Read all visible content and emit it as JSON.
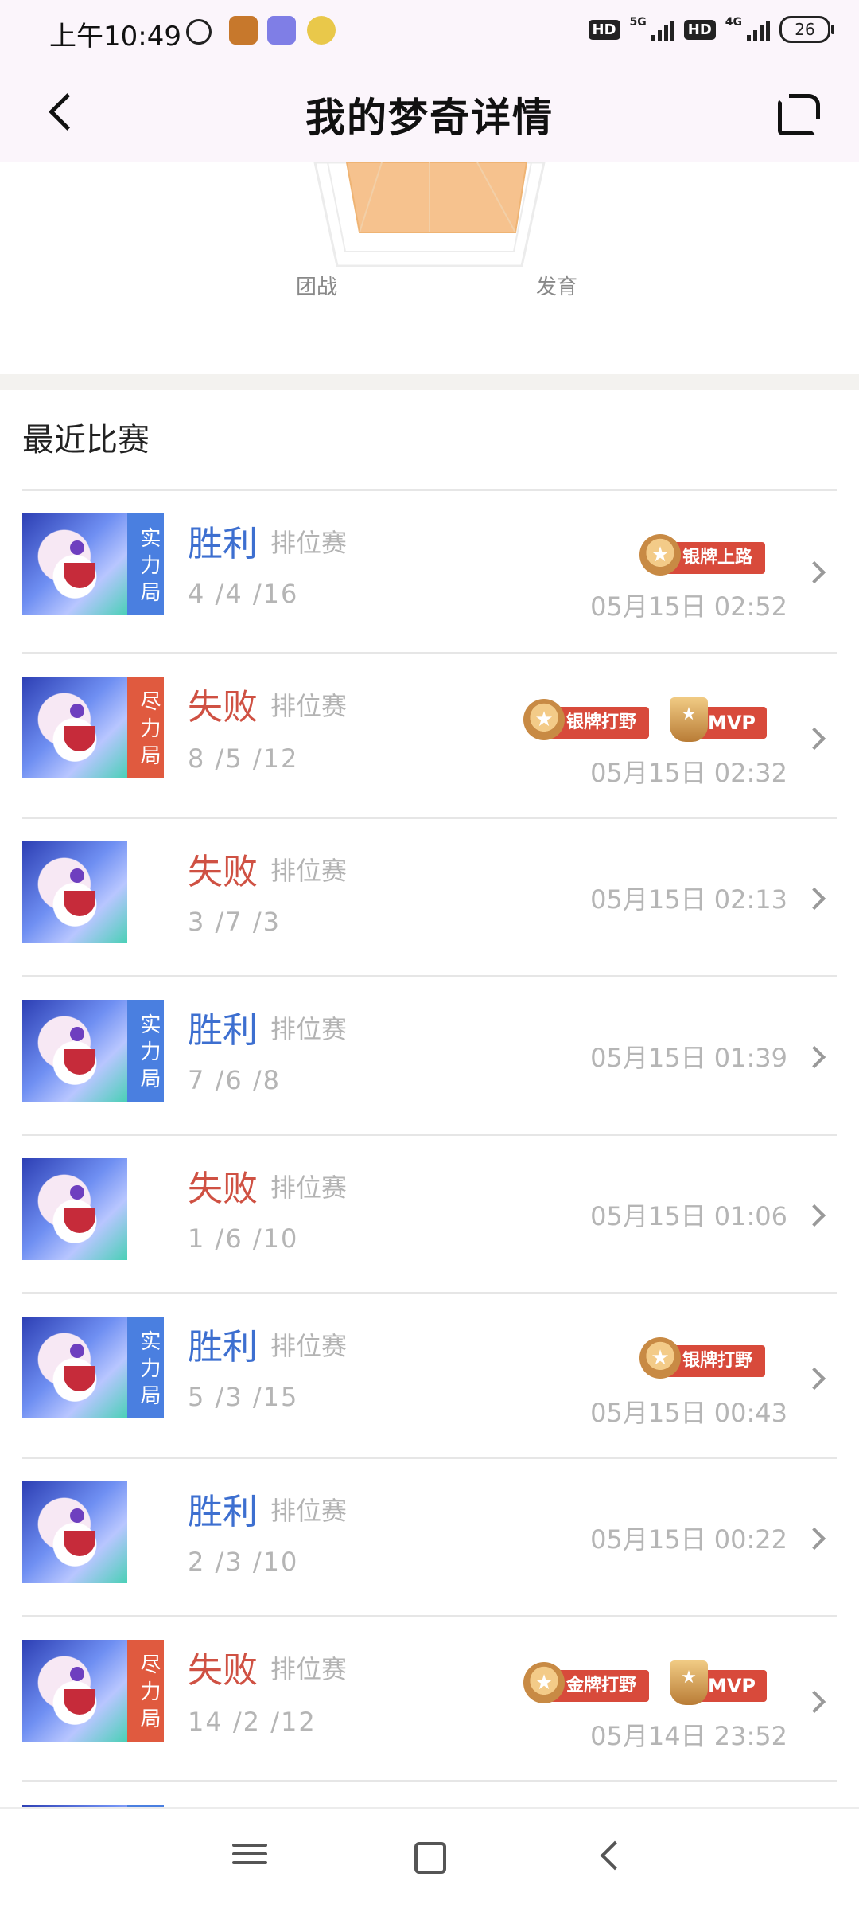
{
  "status_bar": {
    "time": "上午10:49",
    "battery": "26",
    "hd1": "HD",
    "hd2": "HD",
    "net1": "5G",
    "net2": "4G"
  },
  "header": {
    "title": "我的梦奇详情"
  },
  "radar": {
    "labels": [
      "团战",
      "发育"
    ],
    "fill_color": "#f6c28e"
  },
  "recent": {
    "title": "最近比赛",
    "matches": [
      {
        "result": "胜利",
        "mode": "排位赛",
        "kda": "4 /4 /16",
        "time": "05月15日 02:52",
        "tier": "实力局",
        "badges": [
          "银牌上路"
        ],
        "mvp": ""
      },
      {
        "result": "失败",
        "mode": "排位赛",
        "kda": "8 /5 /12",
        "time": "05月15日 02:32",
        "tier": "尽力局",
        "badges": [
          "银牌打野"
        ],
        "mvp": "MVP"
      },
      {
        "result": "失败",
        "mode": "排位赛",
        "kda": "3 /7 /3",
        "time": "05月15日 02:13",
        "tier": "",
        "badges": [],
        "mvp": ""
      },
      {
        "result": "胜利",
        "mode": "排位赛",
        "kda": "7 /6 /8",
        "time": "05月15日 01:39",
        "tier": "实力局",
        "badges": [],
        "mvp": ""
      },
      {
        "result": "失败",
        "mode": "排位赛",
        "kda": "1 /6 /10",
        "time": "05月15日 01:06",
        "tier": "",
        "badges": [],
        "mvp": ""
      },
      {
        "result": "胜利",
        "mode": "排位赛",
        "kda": "5 /3 /15",
        "time": "05月15日 00:43",
        "tier": "实力局",
        "badges": [
          "银牌打野"
        ],
        "mvp": ""
      },
      {
        "result": "胜利",
        "mode": "排位赛",
        "kda": "2 /3 /10",
        "time": "05月15日 00:22",
        "tier": "",
        "badges": [],
        "mvp": ""
      },
      {
        "result": "失败",
        "mode": "排位赛",
        "kda": "14 /2 /12",
        "time": "05月14日 23:52",
        "tier": "尽力局",
        "badges": [
          "金牌打野"
        ],
        "mvp": "MVP"
      }
    ]
  }
}
